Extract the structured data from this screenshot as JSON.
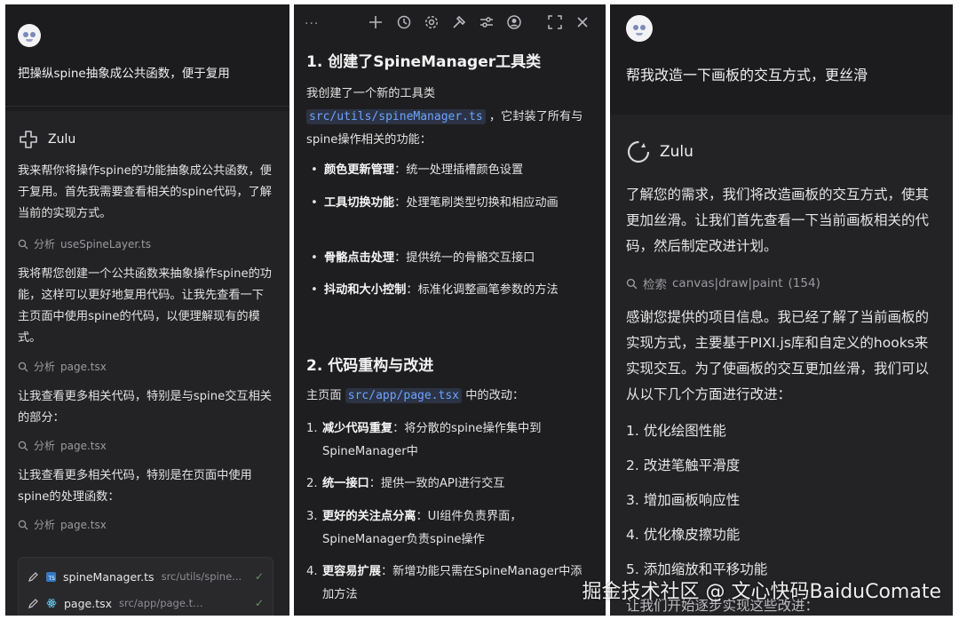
{
  "panel1": {
    "user_message": "把操纵spine抽象成公共函数，便于复用",
    "assistant_name": "Zulu",
    "paragraphs": [
      "我来帮你将操作spine的功能抽象成公共函数，便于复用。首先我需要查看相关的spine代码，了解当前的实现方式。",
      "我将帮您创建一个公共函数来抽象操作spine的功能，这样可以更好地复用代码。让我先查看一下主页面中使用spine的代码，以便理解现有的模式。",
      "让我查看更多相关代码，特别是与spine交互相关的部分：",
      "让我查看更多相关代码，特别是在页面中使用spine的处理函数："
    ],
    "tools": [
      {
        "action": "分析",
        "target": "useSpineLayer.ts"
      },
      {
        "action": "分析",
        "target": "page.tsx"
      },
      {
        "action": "分析",
        "target": "page.tsx"
      },
      {
        "action": "分析",
        "target": "page.tsx"
      }
    ],
    "files": [
      {
        "name": "spineManager.ts",
        "path": "src/utils/spine...",
        "icon": "typescript-icon"
      },
      {
        "name": "page.tsx",
        "path": "src/app/page.tsx",
        "icon": "react-icon"
      }
    ]
  },
  "panel2": {
    "toolbar": {
      "more": "···"
    },
    "section1_title": "1. 创建了SpineManager工具类",
    "section1_intro_a": "我创建了一个新的工具类",
    "section1_code": "src/utils/spineManager.ts",
    "section1_intro_b": "，它封装了所有与spine操作相关的功能：",
    "bullets": [
      {
        "bold": "颜色更新管理",
        "text": "：统一处理插槽颜色设置"
      },
      {
        "bold": "工具切换功能",
        "text": "：处理笔刷类型切换和相应动画"
      },
      {
        "bold": "骨骼点击处理",
        "text": "：提供统一的骨骼交互接口"
      },
      {
        "bold": "抖动和大小控制",
        "text": "：标准化调整画笔参数的方法"
      }
    ],
    "section2_title": "2. 代码重构与改进",
    "section2_intro_a": "主页面",
    "section2_code": "src/app/page.tsx",
    "section2_intro_b": "中的改动：",
    "items": [
      {
        "num": "1.",
        "bold": "减少代码重复",
        "text": "：将分散的spine操作集中到SpineManager中"
      },
      {
        "num": "2.",
        "bold": "统一接口",
        "text": "：提供一致的API进行交互"
      },
      {
        "num": "3.",
        "bold": "更好的关注点分离",
        "text": "：UI组件负责界面，SpineManager负责spine操作"
      },
      {
        "num": "4.",
        "bold": "更容易扩展",
        "text": "：新增功能只需在SpineManager中添加方法"
      }
    ]
  },
  "panel3": {
    "user_message": "帮我改造一下画板的交互方式，更丝滑",
    "assistant_name": "Zulu",
    "paragraph1": "了解您的需求，我们将改造画板的交互方式，使其更加丝滑。让我们首先查看一下当前画板相关的代码，然后制定改进计划。",
    "tool": {
      "action": "检索",
      "target": "canvas|draw|paint",
      "count": "(154)"
    },
    "paragraph2": "感谢您提供的项目信息。我已经了解了当前画板的实现方式，主要基于PIXI.js库和自定义的hooks来实现交互。为了使画板的交互更加丝滑，我们可以从以下几个方面进行改进：",
    "list": [
      "1. 优化绘图性能",
      "2. 改进笔触平滑度",
      "3. 增加画板响应性",
      "4. 优化橡皮擦功能",
      "5. 添加缩放和平移功能"
    ],
    "trailing": "让我们开始逐步实现这些改进："
  },
  "watermark": "掘金技术社区 @ 文心快码BaiduComate"
}
